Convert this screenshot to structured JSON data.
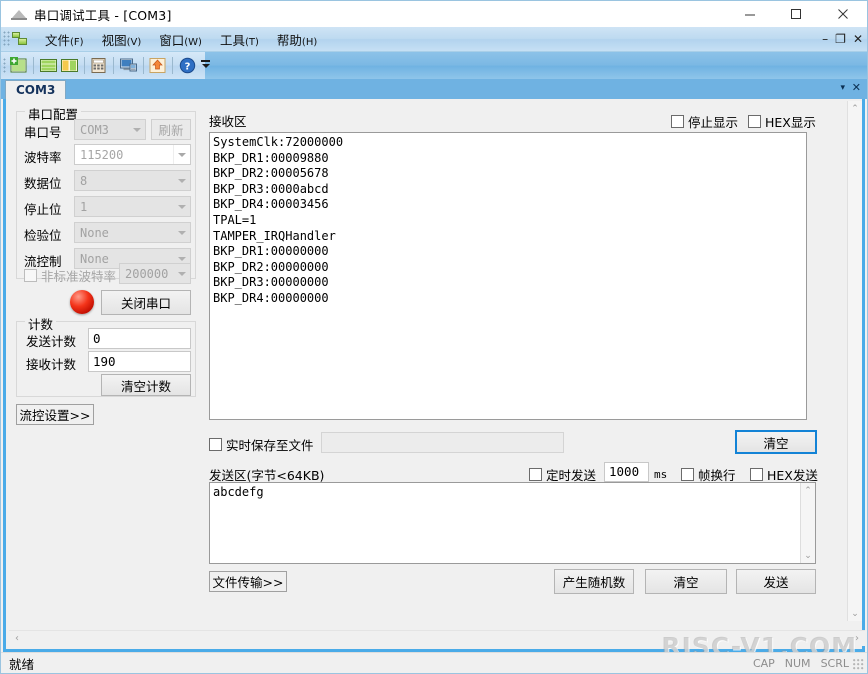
{
  "window": {
    "title": "串口调试工具 - [COM3]",
    "app_icon": "serial-tool-icon",
    "minimize": "–",
    "maximize": "□",
    "close": "✕"
  },
  "mdi_child": {
    "minimize": "–",
    "restore": "❐",
    "close": "✕"
  },
  "menu": {
    "items": [
      {
        "label": "文件",
        "mnemonic": "(F)"
      },
      {
        "label": "视图",
        "mnemonic": "(V)"
      },
      {
        "label": "窗口",
        "mnemonic": "(W)"
      },
      {
        "label": "工具",
        "mnemonic": "(T)"
      },
      {
        "label": "帮助",
        "mnemonic": "(H)"
      }
    ]
  },
  "toolbar": {
    "buttons": [
      {
        "icon": "new-session-icon"
      },
      {
        "icon": "tile-horizontal-icon"
      },
      {
        "icon": "tile-vertical-icon"
      },
      {
        "icon": "calculator-icon"
      },
      {
        "icon": "remote-computer-icon"
      },
      {
        "icon": "upload-icon"
      },
      {
        "icon": "help-icon"
      }
    ]
  },
  "tabs": {
    "items": [
      {
        "label": "COM3"
      }
    ],
    "active": "COM3",
    "chevron": "▾",
    "close": "✕"
  },
  "serial_config": {
    "title": "串口配置",
    "fields": [
      {
        "label": "串口号",
        "value": "COM3",
        "enabled": false
      },
      {
        "label": "波特率",
        "value": "115200",
        "enabled": true
      },
      {
        "label": "数据位",
        "value": "8",
        "enabled": false
      },
      {
        "label": "停止位",
        "value": "1",
        "enabled": false
      },
      {
        "label": "检验位",
        "value": "None",
        "enabled": false
      },
      {
        "label": "流控制",
        "value": "None",
        "enabled": false
      }
    ],
    "refresh_button": "刷新",
    "nonstandard_baud": {
      "label": "非标准波特率",
      "checked": false,
      "value": "200000"
    },
    "port_state_led": "red-led-icon",
    "toggle_port_button": "关闭串口"
  },
  "counters": {
    "title": "计数",
    "tx_label": "发送计数",
    "tx_value": "0",
    "rx_label": "接收计数",
    "rx_value": "190",
    "clear_button": "清空计数"
  },
  "flow_control_button": "流控设置>>",
  "receive": {
    "title": "接收区",
    "stop_display": {
      "label": "停止显示",
      "checked": false
    },
    "hex_display": {
      "label": "HEX显示",
      "checked": false
    },
    "text": "SystemClk:72000000\nBKP_DR1:00009880\nBKP_DR2:00005678\nBKP_DR3:0000abcd\nBKP_DR4:00003456\nTPAL=1\nTAMPER_IRQHandler\nBKP_DR1:00000000\nBKP_DR2:00000000\nBKP_DR3:00000000\nBKP_DR4:00000000",
    "save_to_file": {
      "label": "实时保存至文件",
      "checked": false,
      "path": ""
    },
    "clear_button": "清空"
  },
  "send": {
    "title": "发送区(字节<64KB)",
    "timed_send": {
      "label": "定时发送",
      "checked": false,
      "interval": "1000",
      "unit": "ms"
    },
    "frame_newline": {
      "label": "帧换行",
      "checked": false
    },
    "hex_send": {
      "label": "HEX发送",
      "checked": false
    },
    "text": "abcdefg",
    "file_transfer_button": "文件传输>>",
    "random_button": "产生随机数",
    "clear_button": "清空",
    "send_button": "发送"
  },
  "statusbar": {
    "ready": "就绪",
    "indicators": [
      "CAP",
      "NUM",
      "SCRL"
    ]
  },
  "watermark": "RISC-V1.COM",
  "colors": {
    "accent_blue": "#4aabe8",
    "titlebar_gradient_top": "#cfe4f5",
    "tab_active": "#f0f0f0",
    "led_red": "#f4341a",
    "focus_border": "#1383d6"
  }
}
